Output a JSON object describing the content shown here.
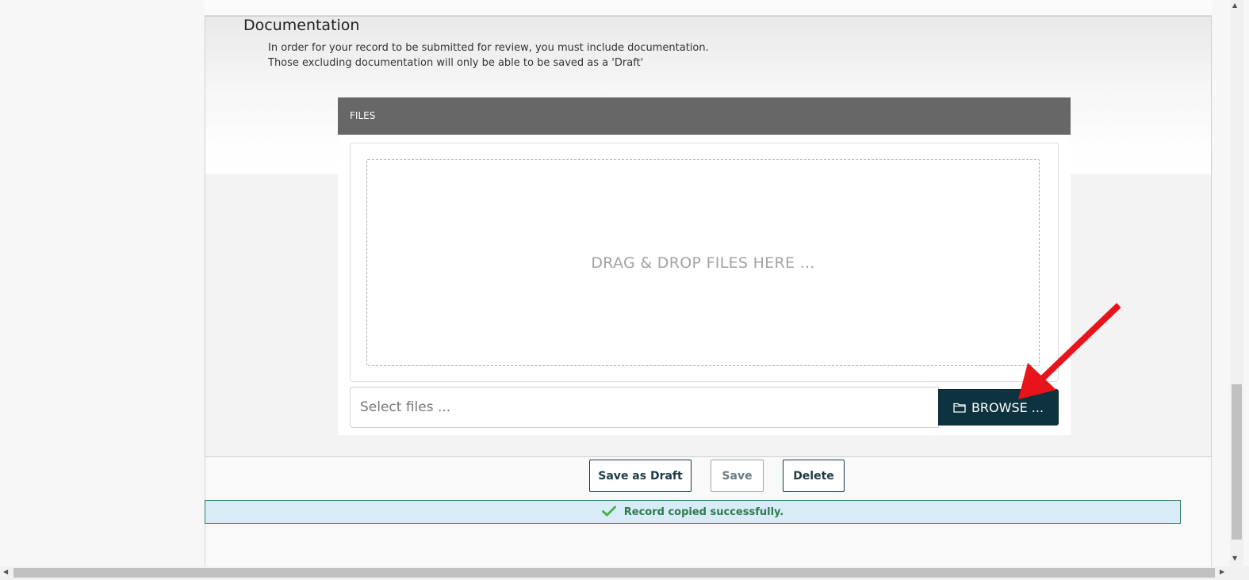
{
  "documentation": {
    "title": "Documentation",
    "line1": "In order for your record to be submitted for review, you must include documentation.",
    "line2": "Those excluding documentation will only be able to be saved as a 'Draft'"
  },
  "files": {
    "header": "FILES",
    "drop_text": "DRAG & DROP FILES HERE ...",
    "select_placeholder": "Select files ...",
    "browse_label": "BROWSE ...",
    "browse_icon": "folder-icon"
  },
  "actions": {
    "save_draft": "Save as Draft",
    "save": "Save",
    "delete": "Delete"
  },
  "status": {
    "message": "Record copied successfully.",
    "icon": "checkmark-icon",
    "color": "#2d7a4e"
  },
  "colors": {
    "accent": "#0d3340",
    "files_header": "#676767",
    "arrow": "#e8141b",
    "success_bg": "#d8ecf8"
  }
}
